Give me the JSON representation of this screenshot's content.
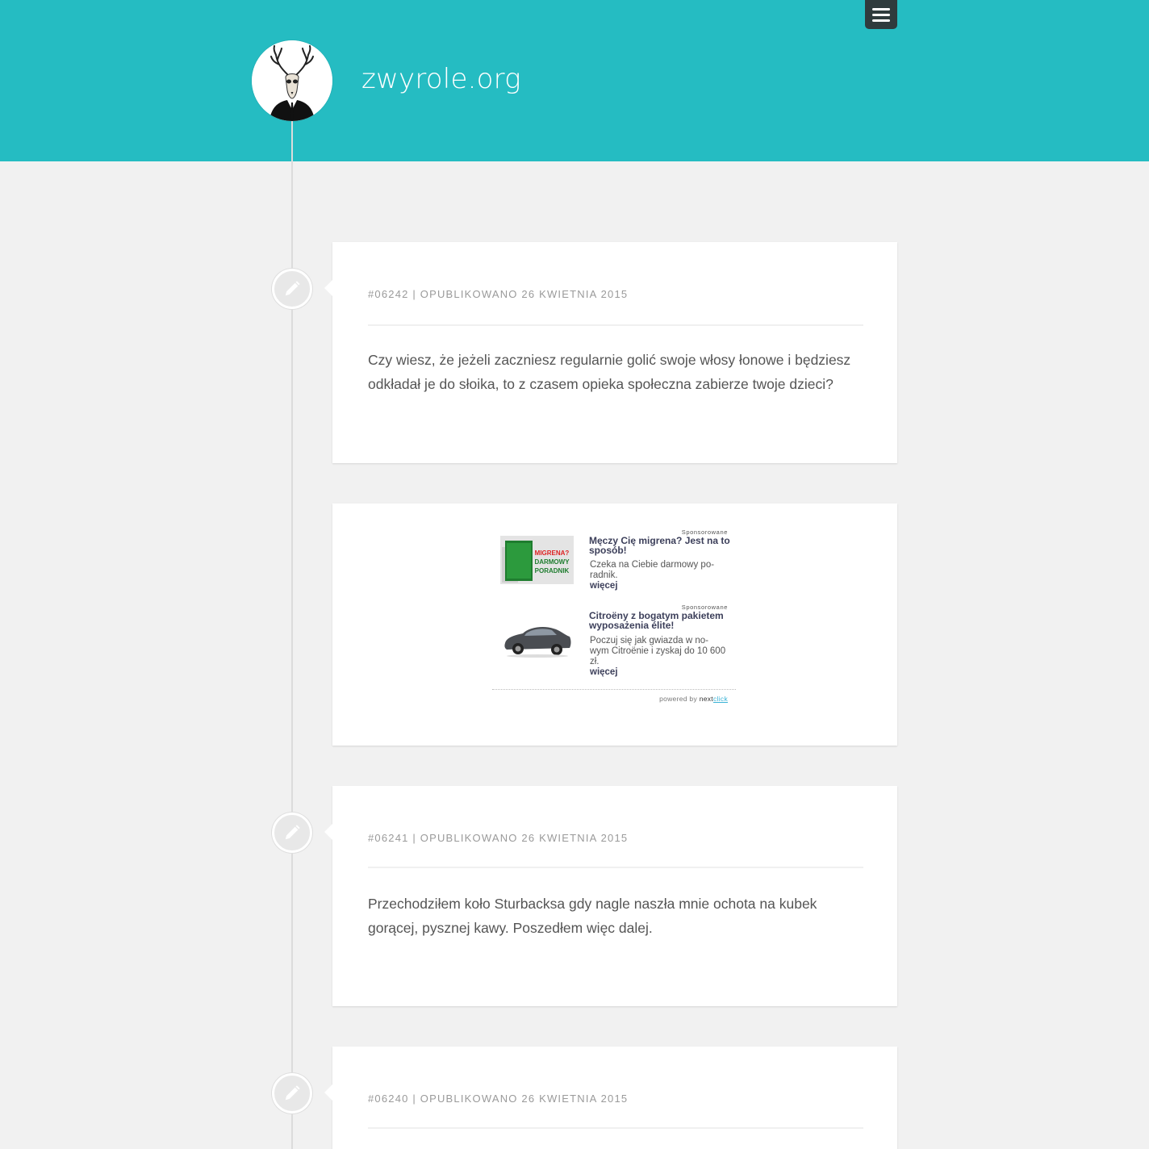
{
  "site": {
    "title": "zwyrole.org",
    "colors": {
      "header": "#25bcc2",
      "background": "#f1f1f1",
      "menu": "#2f3b3d"
    }
  },
  "menu": {
    "icon": "hamburger-icon"
  },
  "posts": [
    {
      "meta": "#06242 | OPUBLIKOWANO 26 KWIETNIA 2015",
      "body": "Czy wiesz, że jeżeli zaczniesz regularnie golić swoje włosy łonowe i będziesz odkładał je do słoika, to z czasem opieka społeczna zabierze twoje dzieci?"
    },
    {
      "meta": "#06241 | OPUBLIKOWANO 26 KWIETNIA 2015",
      "body": "Przechodziłem koło Sturbacksa gdy nagle naszła mnie ochota na kubek gorącej, pysznej kawy. Poszedłem więc dalej."
    },
    {
      "meta": "#06240 | OPUBLIKOWANO 26 KWIETNIA 2015",
      "body": ""
    }
  ],
  "ad": {
    "items": [
      {
        "sponsored": "Sponsorowane",
        "title": "Męczy Cię migrena? Jest na to sposób!",
        "desc": "Czeka na Ciebie darmowy po-radnik.",
        "more": "więcej",
        "image_text_1": "MIGRENA?",
        "image_text_2": "DARMOWY",
        "image_text_3": "PORADNIK"
      },
      {
        "sponsored": "Sponsorowane",
        "title": "Citroëny z bogatym pakietem wyposażenia élite!",
        "desc": "Poczuj się jak gwiazda w no-wym Citroënie i zyskaj do 10 600 zł.",
        "more": "więcej"
      }
    ],
    "powered_by": "powered by",
    "brand_next": "next",
    "brand_click": "click"
  }
}
